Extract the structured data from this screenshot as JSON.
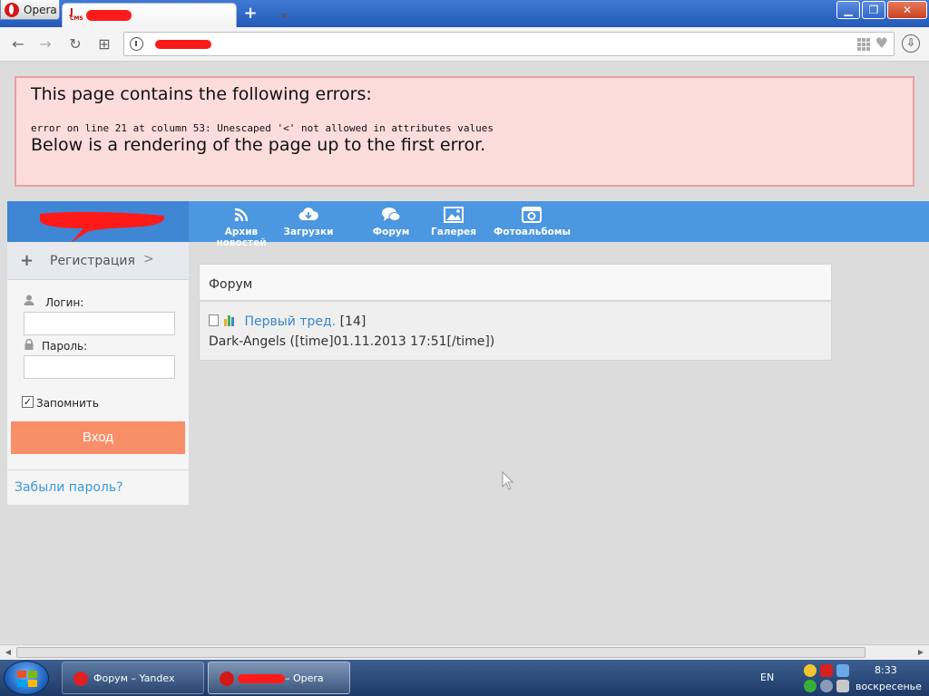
{
  "browser": {
    "menu_label": "Opera",
    "tab_close": "✕",
    "new_tab": "+",
    "window_buttons": {
      "minimize": "▁",
      "maximize": "❐",
      "close": "✕"
    },
    "nav": {
      "back": "←",
      "forward": "→",
      "reload": "↻",
      "speed_dial": "⊞",
      "download": "⇩"
    }
  },
  "error": {
    "title": "This page contains the following errors:",
    "detail": "error on line 21 at column 53: Unescaped '<' not allowed in attributes values",
    "below": "Below is a rendering of the page up to the first error."
  },
  "menu": [
    {
      "label": "Архив новостей",
      "icon": "rss-icon"
    },
    {
      "label": "Загрузки",
      "icon": "cloud-download-icon"
    },
    {
      "label": "Форум",
      "icon": "chat-bubbles-icon"
    },
    {
      "label": "Галерея",
      "icon": "image-icon"
    },
    {
      "label": "Фотоальбомы",
      "icon": "camera-icon"
    }
  ],
  "sidebar": {
    "register_plus": "+",
    "register_label": "Регистрация",
    "register_chevron": ">",
    "login_label": "Логин:",
    "password_label": "Пароль:",
    "login_value": "",
    "password_value": "",
    "remember_label": "Запомнить",
    "remember_checked": true,
    "login_button": "Вход",
    "forgot_link": "Забыли пароль?"
  },
  "forum": {
    "title": "Форум",
    "thread": {
      "title": "Первый тред.",
      "count": "[14]",
      "meta": "Dark-Angels ([time]01.11.2013 17:51[/time])"
    }
  },
  "taskbar": {
    "tasks": [
      {
        "label": "Форум – Yandex"
      },
      {
        "label": "– Opera"
      }
    ],
    "language": "EN",
    "time": "8:33",
    "day": "воскресенье"
  },
  "colors": {
    "header_blue": "#4b97e0",
    "login_button": "#f98f68",
    "link_blue": "#3a9ad9",
    "error_bg": "#fddcdc"
  }
}
